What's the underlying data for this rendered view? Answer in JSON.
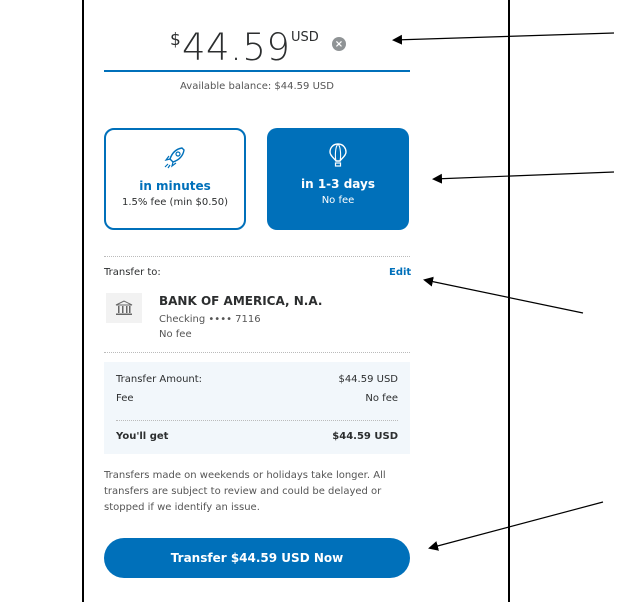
{
  "amount": {
    "symbol": "$",
    "value": "44.59",
    "currency": "USD",
    "clear_icon": "×"
  },
  "balance_text": "Available balance: $44.59 USD",
  "speed_options": [
    {
      "title": "in minutes",
      "subtitle": "1.5% fee (min $0.50)",
      "icon": "rocket-icon",
      "selected": false
    },
    {
      "title": "in 1-3 days",
      "subtitle": "No fee",
      "icon": "hot-air-balloon-icon",
      "selected": true
    }
  ],
  "transfer_to": {
    "label": "Transfer to:",
    "edit_label": "Edit",
    "bank_name": "BANK OF AMERICA, N.A.",
    "account": "Checking •••• 7116",
    "fee": "No fee",
    "bank_icon": "bank-icon"
  },
  "summary": {
    "transfer_amount_label": "Transfer Amount:",
    "transfer_amount_value": "$44.59 USD",
    "fee_label": "Fee",
    "fee_value": "No fee",
    "you_get_label": "You'll get",
    "you_get_value": "$44.59 USD"
  },
  "notice": "Transfers made on weekends or holidays take longer. All transfers are subject to review and could be delayed or stopped if we identify an issue.",
  "transfer_button_label": "Transfer $44.59 USD Now",
  "colors": {
    "accent": "#0070ba",
    "summary_bg": "#f2f7fb"
  }
}
